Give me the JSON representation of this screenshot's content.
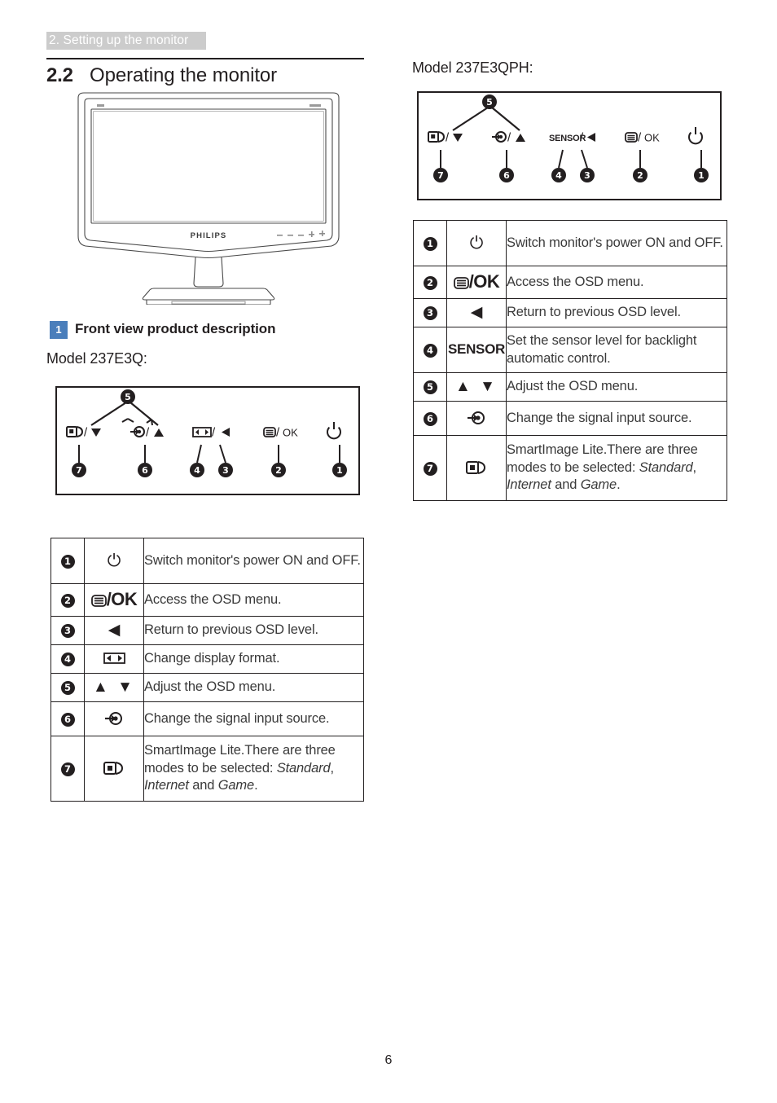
{
  "running_header": "2. Setting up the monitor",
  "section": {
    "number": "2.2",
    "title": "Operating the monitor"
  },
  "subsection": {
    "badge": "1",
    "label": "Front view product description"
  },
  "models": {
    "left_label": "Model 237E3Q:",
    "right_label": "Model 237E3QPH:"
  },
  "keypad_left": {
    "caption": "Front control keypad diagram for model 237E3Q",
    "keys": [
      {
        "number": "7",
        "glyph": "smartimage/down",
        "icon": "smartimage-icon"
      },
      {
        "number": "6",
        "glyph": "input/up",
        "icon": "input-source-icon"
      },
      {
        "number": "4",
        "glyph": "format",
        "icon": "display-format-icon"
      },
      {
        "number": "3",
        "glyph": "back",
        "icon": "left-arrow-icon"
      },
      {
        "number": "2",
        "glyph": "menu/OK",
        "icon": "osd-menu-icon"
      },
      {
        "number": "1",
        "glyph": "power",
        "icon": "power-icon"
      },
      {
        "number": "5",
        "glyph": "up-down",
        "icon": "adjust-icon"
      }
    ]
  },
  "keypad_right": {
    "caption": "Front control keypad diagram for model 237E3QPH",
    "keys": [
      {
        "number": "7",
        "glyph": "smartimage/down",
        "icon": "smartimage-icon"
      },
      {
        "number": "6",
        "glyph": "input/up",
        "icon": "input-source-icon"
      },
      {
        "number": "4",
        "glyph": "SENSOR",
        "icon": "sensor-icon"
      },
      {
        "number": "3",
        "glyph": "back",
        "icon": "left-arrow-icon"
      },
      {
        "number": "2",
        "glyph": "menu/OK",
        "icon": "osd-menu-icon"
      },
      {
        "number": "1",
        "glyph": "power",
        "icon": "power-icon"
      },
      {
        "number": "5",
        "glyph": "up-down",
        "icon": "adjust-icon"
      }
    ]
  },
  "table_left": {
    "rows": [
      {
        "number": "1",
        "icon": "power-icon",
        "icon_text": "⏻",
        "desc": "Switch monitor's power ON and OFF."
      },
      {
        "number": "2",
        "icon": "osd-menu-ok-icon",
        "icon_text": "/OK",
        "desc": "Access the OSD menu."
      },
      {
        "number": "3",
        "icon": "left-arrow-icon",
        "icon_text": "◀",
        "desc": "Return to previous OSD level."
      },
      {
        "number": "4",
        "icon": "display-format-icon",
        "icon_text": "",
        "desc": "Change display format."
      },
      {
        "number": "5",
        "icon": "up-down-arrows-icon",
        "icon_text": "▲ ▼",
        "desc": "Adjust the OSD menu."
      },
      {
        "number": "6",
        "icon": "input-source-icon",
        "icon_text": "",
        "desc": "Change the signal input source."
      },
      {
        "number": "7",
        "icon": "smartimage-icon",
        "icon_text": "",
        "desc_pre": "SmartImage Lite.There are three modes to be selected: ",
        "desc_i1": "Standard",
        "desc_mid1": ", ",
        "desc_i2": "Internet",
        "desc_mid2": " and ",
        "desc_i3": "Game",
        "desc_post": "."
      }
    ]
  },
  "table_right": {
    "rows": [
      {
        "number": "1",
        "icon": "power-icon",
        "icon_text": "⏻",
        "desc": "Switch monitor's power ON and OFF."
      },
      {
        "number": "2",
        "icon": "osd-menu-ok-icon",
        "icon_text": "/OK",
        "desc": "Access the OSD menu."
      },
      {
        "number": "3",
        "icon": "left-arrow-icon",
        "icon_text": "◀",
        "desc": "Return to previous OSD level."
      },
      {
        "number": "4",
        "icon": "sensor-icon",
        "icon_text": "SENSOR",
        "desc": "Set the sensor level for backlight automatic control."
      },
      {
        "number": "5",
        "icon": "up-down-arrows-icon",
        "icon_text": "▲ ▼",
        "desc": "Adjust the OSD menu."
      },
      {
        "number": "6",
        "icon": "input-source-icon",
        "icon_text": "",
        "desc": "Change the signal input source."
      },
      {
        "number": "7",
        "icon": "smartimage-icon",
        "icon_text": "",
        "desc_pre": "SmartImage Lite.There are three modes to be selected: ",
        "desc_i1": "Standard",
        "desc_mid1": ", ",
        "desc_i2": "Internet",
        "desc_mid2": " and ",
        "desc_i3": "Game",
        "desc_post": "."
      }
    ]
  },
  "monitor_illustration": {
    "brand": "PHILIPS"
  },
  "page_number": "6",
  "colors": {
    "header_band": "#cccccc",
    "badge_blue": "#4a7ebb",
    "ink": "#231f20",
    "body_text": "#3a3a3a"
  }
}
